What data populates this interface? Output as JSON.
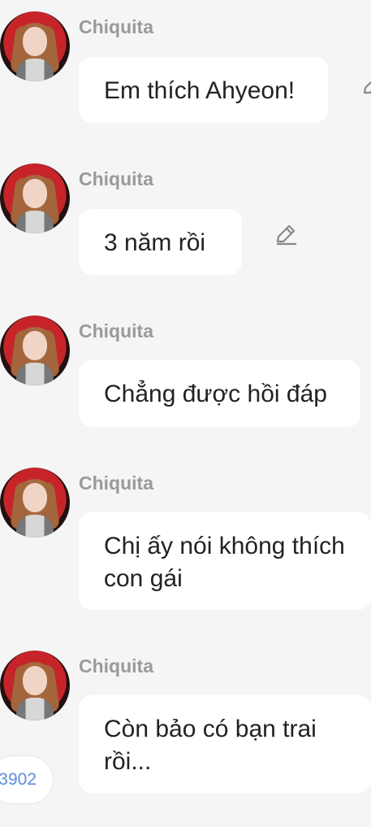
{
  "messages": [
    {
      "sender": "Chiquita",
      "text": "Em thích Ahyeon!"
    },
    {
      "sender": "Chiquita",
      "text": "3 năm rồi"
    },
    {
      "sender": "Chiquita",
      "text": "Chẳng được hồi đáp"
    },
    {
      "sender": "Chiquita",
      "text": "Chị ấy nói không thích con gái"
    },
    {
      "sender": "Chiquita",
      "text": "Còn bảo có bạn trai rồi..."
    }
  ],
  "counter": {
    "text": "3902"
  },
  "colors": {
    "background": "#f5f5f5",
    "bubble": "#ffffff",
    "sender": "#9a9a9a",
    "counter": "#5c8edb"
  },
  "icons": {
    "edit": "pencil-icon"
  }
}
